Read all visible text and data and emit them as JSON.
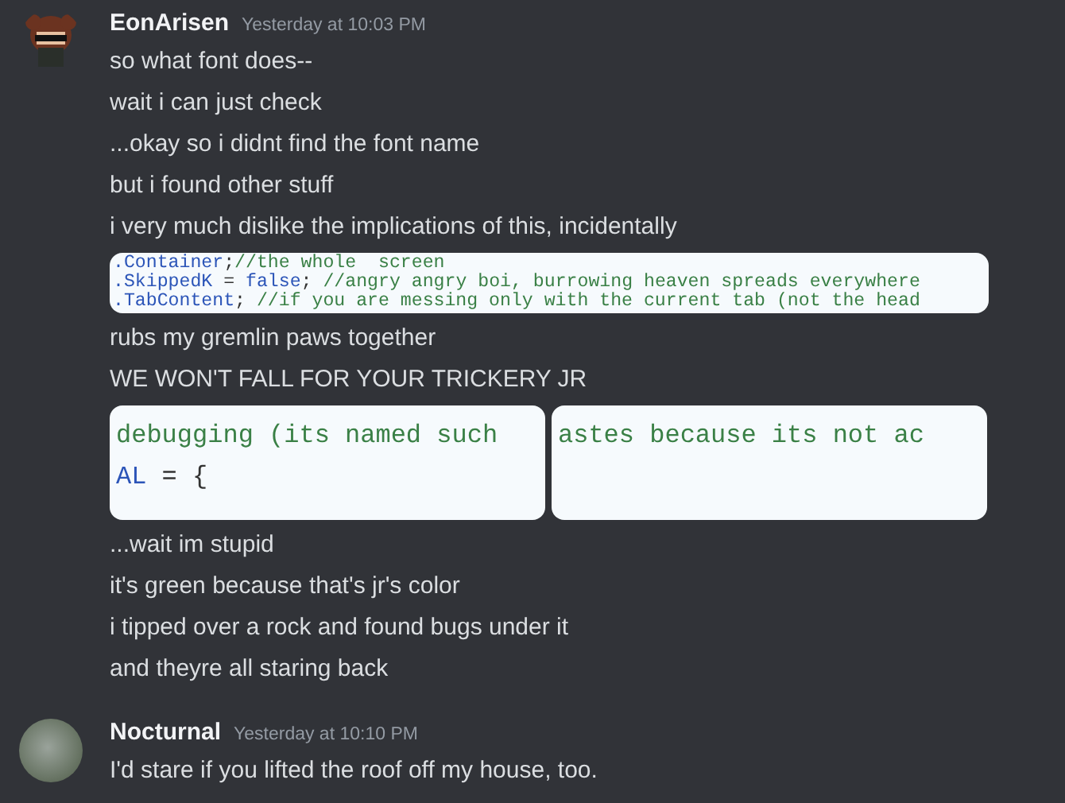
{
  "messages": [
    {
      "author": "EonArisen",
      "timestamp": "Yesterday at 10:03 PM",
      "avatar": {
        "kind": "drawing"
      },
      "items": [
        {
          "kind": "text",
          "text": "so what font does--"
        },
        {
          "kind": "text",
          "text": "wait i can just check"
        },
        {
          "kind": "text",
          "text": "...okay so i didnt find the font name"
        },
        {
          "kind": "text",
          "text": "but i found other stuff"
        },
        {
          "kind": "text",
          "text": "i very much dislike the implications of this, incidentally"
        },
        {
          "kind": "codestrip",
          "images": [
            {
              "lines": [
                [
                  {
                    "kind": "keyword",
                    "text": ".Container"
                  },
                  {
                    "kind": "plain",
                    "text": ";"
                  },
                  {
                    "kind": "comment",
                    "text": "//the whole  screen"
                  }
                ],
                [
                  {
                    "kind": "keyword",
                    "text": ".SkippedK"
                  },
                  {
                    "kind": "plain",
                    "text": " = "
                  },
                  {
                    "kind": "keyword",
                    "text": "false"
                  },
                  {
                    "kind": "plain",
                    "text": "; "
                  },
                  {
                    "kind": "comment",
                    "text": "//angry angry boi, burrowing heaven spreads everywhere"
                  }
                ],
                [
                  {
                    "kind": "keyword",
                    "text": ".TabContent"
                  },
                  {
                    "kind": "plain",
                    "text": "; "
                  },
                  {
                    "kind": "comment",
                    "text": "//if you are messing only with the current tab (not the head"
                  }
                ]
              ]
            }
          ]
        },
        {
          "kind": "text",
          "text": "rubs my gremlin paws together"
        },
        {
          "kind": "text",
          "text": "WE WON'T FALL FOR YOUR TRICKERY JR"
        },
        {
          "kind": "codepair",
          "images": [
            {
              "lines": [
                [
                  {
                    "kind": "comment",
                    "text": "debugging (its named such"
                  }
                ],
                [
                  {
                    "kind": "keyword",
                    "text": "AL"
                  },
                  {
                    "kind": "plain",
                    "text": " = {"
                  }
                ]
              ]
            },
            {
              "lines": [
                [
                  {
                    "kind": "comment",
                    "text": "astes because its not ac"
                  }
                ]
              ]
            }
          ]
        },
        {
          "kind": "text",
          "text": "...wait im stupid"
        },
        {
          "kind": "text",
          "text": "it's green because that's jr's color"
        },
        {
          "kind": "text",
          "text": "i tipped over a rock and found bugs under it"
        },
        {
          "kind": "text",
          "text": "and theyre all staring back"
        }
      ]
    },
    {
      "author": "Nocturnal",
      "timestamp": "Yesterday at 10:10 PM",
      "avatar": {
        "kind": "photo"
      },
      "items": [
        {
          "kind": "text",
          "text": "I'd stare if you lifted the roof off my house, too."
        }
      ]
    }
  ]
}
